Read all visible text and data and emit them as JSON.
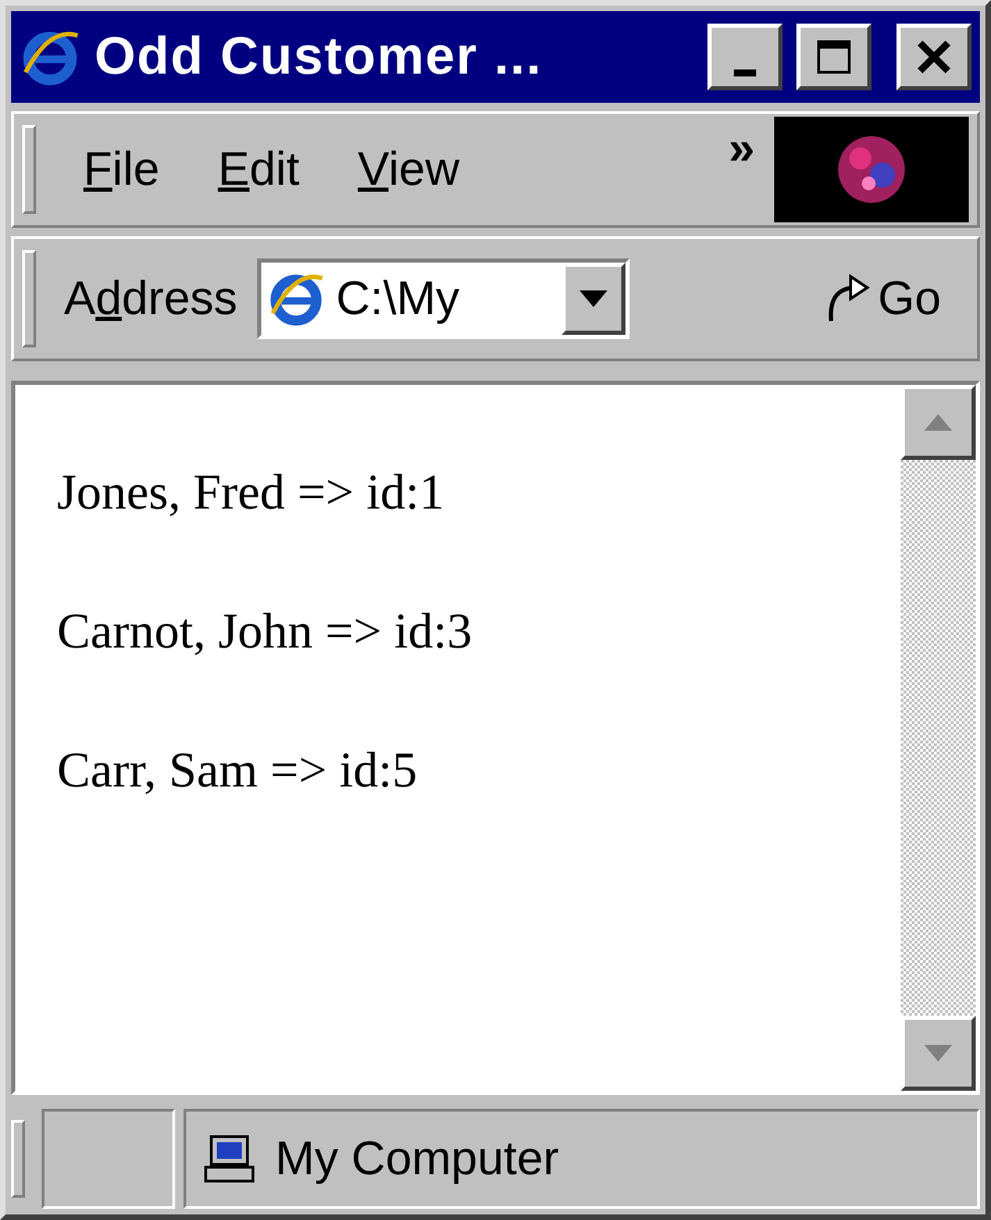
{
  "window": {
    "title": "Odd Customer ..."
  },
  "menu": [
    {
      "key": "F",
      "rest": "ile"
    },
    {
      "key": "E",
      "rest": "dit"
    },
    {
      "key": "V",
      "rest": "iew"
    }
  ],
  "menu_overflow": "»",
  "address_bar": {
    "label": {
      "lead": "A",
      "key": "d",
      "rest": "dress"
    },
    "value": "C:\\My",
    "go": "Go"
  },
  "content": {
    "lines": [
      "Jones, Fred => id:1",
      "Carnot, John => id:3",
      "Carr, Sam => id:5"
    ]
  },
  "status_bar": {
    "zone": "My Computer"
  }
}
